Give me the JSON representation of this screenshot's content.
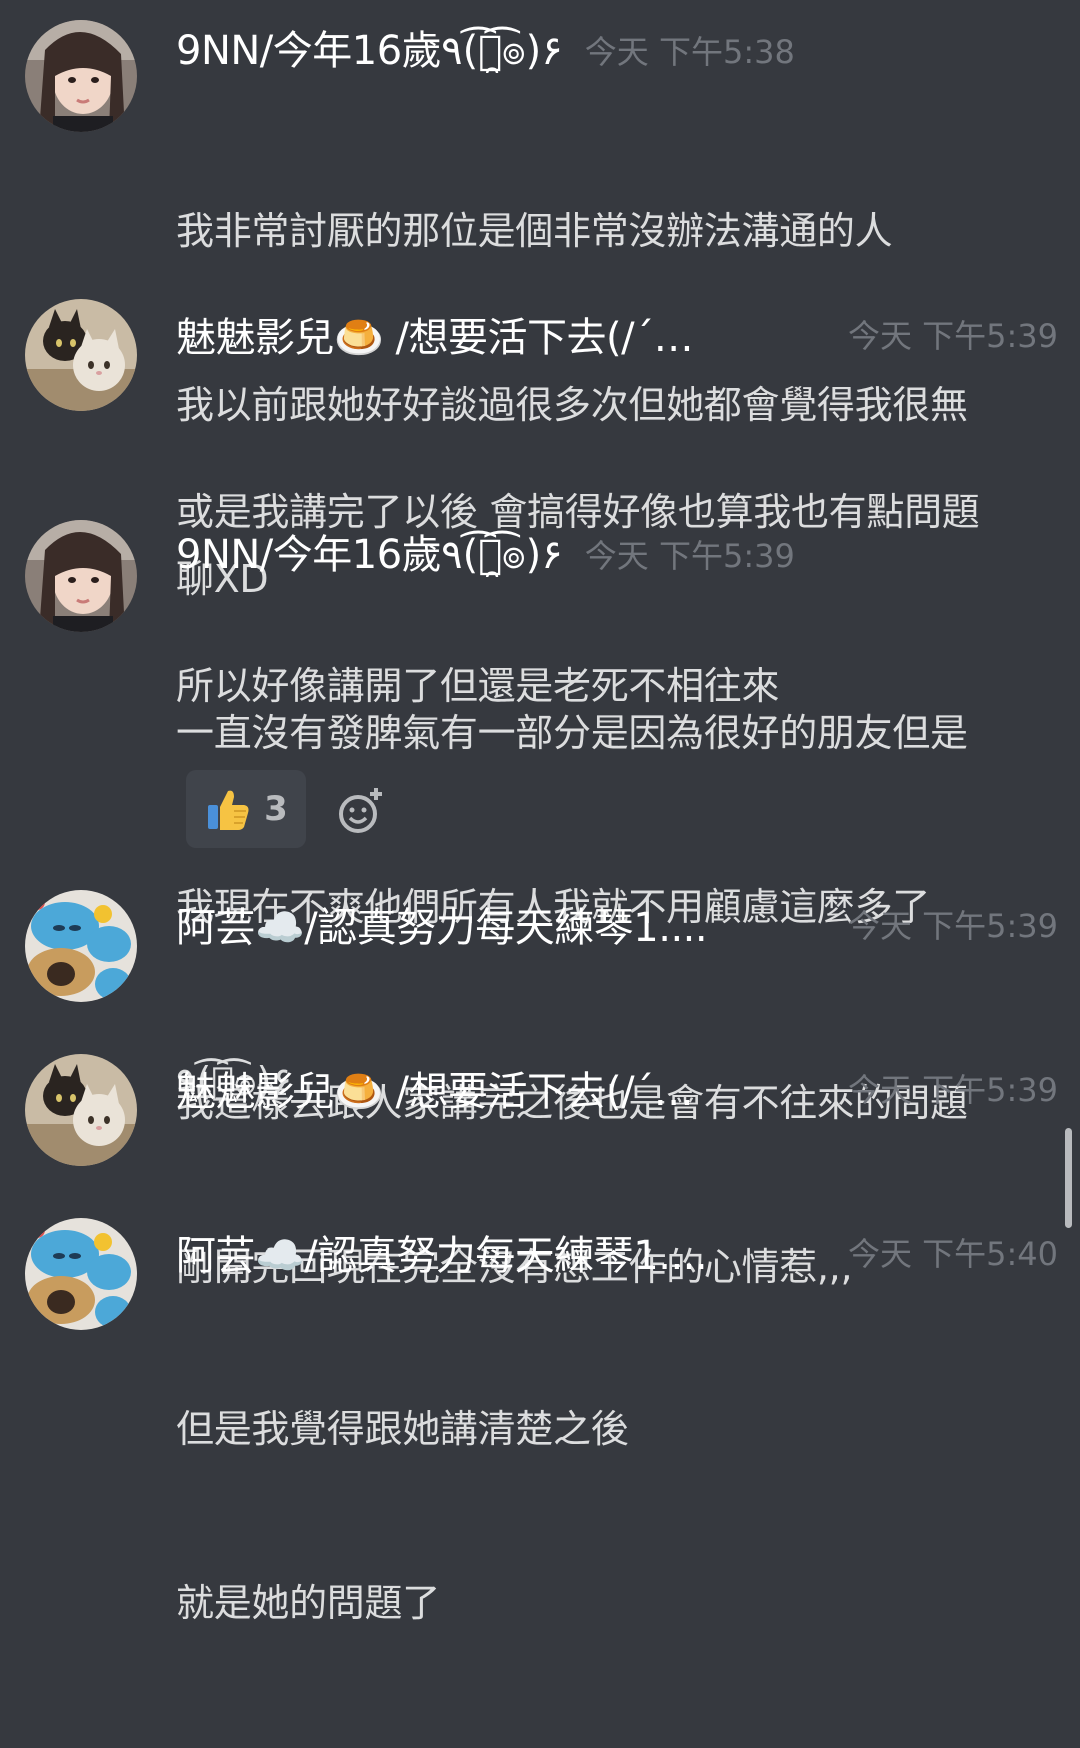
{
  "messages": [
    {
      "username": "9NN/今年16歲٩(͡๏̯͡๏)۶",
      "timestamp": "今天 下午5:38",
      "lines": [
        "我非常討厭的那位是個非常沒辦法溝通的人",
        "我以前跟她好好談過很多次但她都會覺得我很無",
        "聊XD"
      ]
    },
    {
      "username": "魅魅影兒🍮 /想要活下去(/´…",
      "timestamp": "今天 下午5:39",
      "lines": [
        "或是我講完了以後 會搞得好像也算我也有點問題",
        "所以好像講開了但還是老死不相往來"
      ]
    },
    {
      "username": "9NN/今年16歲٩(͡๏̯͡๏)۶",
      "timestamp": "今天 下午5:39",
      "lines": [
        "一直沒有發脾氣有一部分是因為很好的朋友但是",
        "我現在不爽他們所有人我就不用顧慮這麼多了",
        "٩(͡๏̯͡๏)۶"
      ],
      "reactions": [
        {
          "emoji": "thumbs-up-icon",
          "count": "3"
        }
      ]
    },
    {
      "username": "阿芸☁️/認真努力每天練琴1....",
      "timestamp": "今天 下午5:39",
      "lines": [
        "我這樣去跟人家講完之後也是會有不往來的問題"
      ]
    },
    {
      "username": "魅魅影兒🍮 /想要活下去(/´…",
      "timestamp": "今天 下午5:39",
      "lines": [
        "剛開完回現在完全沒有想工作的心情惹,,,"
      ]
    },
    {
      "username": "阿芸☁️/認真努力每天練琴1....",
      "timestamp": "今天 下午5:40",
      "lines": [
        "但是我覺得跟她講清楚之後",
        "就是她的問題了"
      ]
    }
  ],
  "colors": {
    "background": "#36393f",
    "username": "#ffffff",
    "text": "#dcddde",
    "timestamp": "#72767d",
    "reaction_bg": "#40444b"
  }
}
